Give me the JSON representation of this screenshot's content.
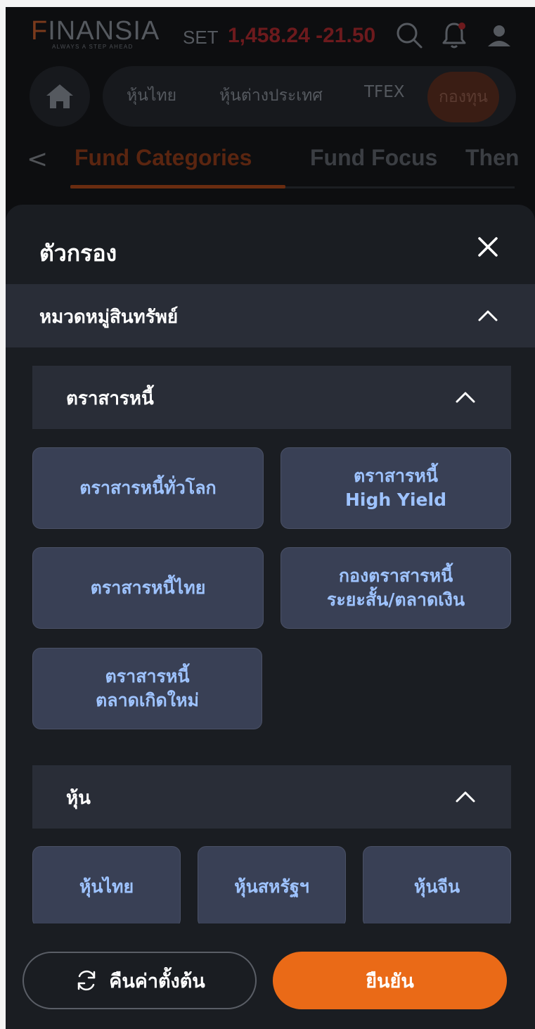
{
  "header": {
    "logo_text": "FINANSIA",
    "logo_tagline": "ALWAYS A STEP AHEAD",
    "index_label": "SET",
    "index_value": "1,458.24",
    "index_change": "-21.50",
    "colors": {
      "logo_accent": "#7a3a1c",
      "index_down": "#6d1a1d"
    }
  },
  "nav": {
    "items": [
      {
        "label": "หุ้นไทย"
      },
      {
        "label": "หุ้นต่างประเทศ"
      },
      {
        "label": "TFEX"
      },
      {
        "label": "กองทุน",
        "active": true
      }
    ]
  },
  "tabs": {
    "items": [
      {
        "label": "Fund Categories",
        "active": true
      },
      {
        "label": "Fund Focus"
      },
      {
        "label": "Then"
      }
    ]
  },
  "filter": {
    "title": "ตัวกรอง",
    "asset_section": {
      "label": "หมวดหมู่สินทรัพย์"
    },
    "bond_group": {
      "label": "ตราสารหนี้",
      "chips": [
        {
          "line1": "ตราสารหนี้ทั่วโลก",
          "line2": ""
        },
        {
          "line1": "ตราสารหนี้",
          "line2": "High Yield"
        },
        {
          "line1": "ตราสารหนี้ไทย",
          "line2": ""
        },
        {
          "line1": "กองตราสารหนี้",
          "line2": "ระยะสั้น/ตลาดเงิน"
        },
        {
          "line1": "ตราสารหนี้",
          "line2": "ตลาดเกิดใหม่"
        }
      ]
    },
    "equity_group": {
      "label": "หุ้น",
      "chips": [
        {
          "line1": "หุ้นไทย"
        },
        {
          "line1": "หุ้นสหรัฐฯ"
        },
        {
          "line1": "หุ้นจีน"
        }
      ]
    },
    "reset_label": "คืนค่าตั้งต้น",
    "confirm_label": "ยืนยัน",
    "colors": {
      "chip_text": "#9ec3ff",
      "confirm_bg": "#ea6a17"
    }
  }
}
